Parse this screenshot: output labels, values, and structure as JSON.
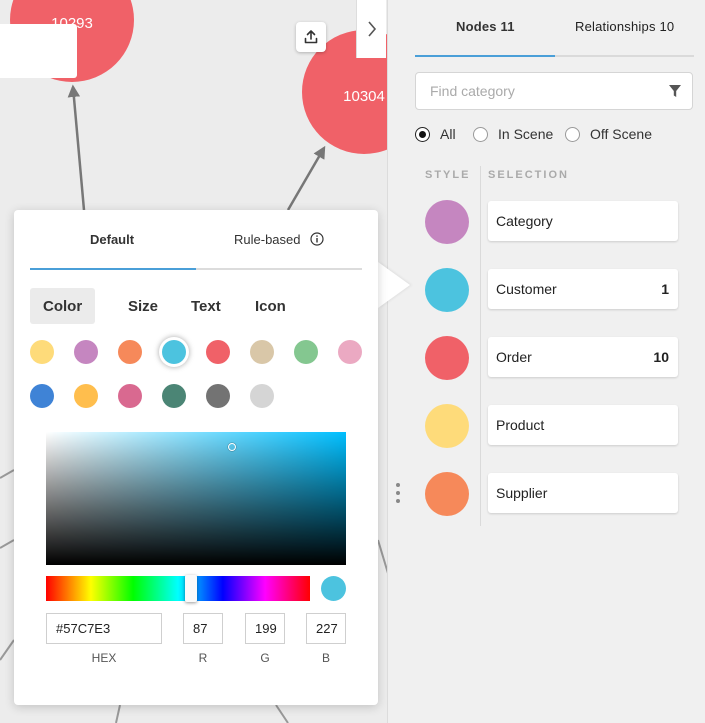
{
  "canvas": {
    "nodes": [
      {
        "label": "10293",
        "color": "#f06168"
      },
      {
        "label": "10304",
        "color": "#f06168"
      }
    ]
  },
  "toolbar": {
    "export_icon": "upload-icon",
    "collapse_icon": "chevron-right-icon"
  },
  "panel": {
    "tabs": [
      {
        "label": "Nodes 11"
      },
      {
        "label": "Relationships 10"
      }
    ],
    "search": {
      "placeholder": "Find category"
    },
    "filter_icon": "filter-icon",
    "scope_options": [
      {
        "label": "All",
        "checked": true
      },
      {
        "label": "In Scene",
        "checked": false
      },
      {
        "label": "Off Scene",
        "checked": false
      }
    ],
    "columns": {
      "style": "STYLE",
      "selection": "SELECTION"
    },
    "categories": [
      {
        "name": "Category",
        "count": "",
        "color": "#c586c0"
      },
      {
        "name": "Customer",
        "count": "1",
        "color": "#4cc3df"
      },
      {
        "name": "Order",
        "count": "10",
        "color": "#f06168"
      },
      {
        "name": "Product",
        "count": "",
        "color": "#fedb7a"
      },
      {
        "name": "Supplier",
        "count": "",
        "color": "#f6895a"
      }
    ]
  },
  "popover": {
    "tabs": [
      {
        "label": "Default"
      },
      {
        "label": "Rule-based"
      }
    ],
    "subtabs": [
      {
        "label": "Color"
      },
      {
        "label": "Size"
      },
      {
        "label": "Text"
      },
      {
        "label": "Icon"
      }
    ],
    "palette": [
      "#fedb7a",
      "#c586c0",
      "#f6895a",
      "#4cc3df",
      "#f06168",
      "#d9c7a8",
      "#84c790",
      "#eba9c2",
      "#3f83d6",
      "#ffbe4d",
      "#d96990",
      "#4b8575",
      "#737373",
      "#d5d5d5"
    ],
    "selected_swatch_index": 3,
    "picker": {
      "hue_color": "#00bfff",
      "hue_position": 0.55,
      "saturation": 0.62,
      "value": 0.89,
      "preview_color": "#4cc3df"
    },
    "hex": {
      "value": "#57C7E3",
      "label": "HEX"
    },
    "rgb": [
      {
        "value": "87",
        "label": "R"
      },
      {
        "value": "199",
        "label": "G"
      },
      {
        "value": "227",
        "label": "B"
      }
    ]
  }
}
